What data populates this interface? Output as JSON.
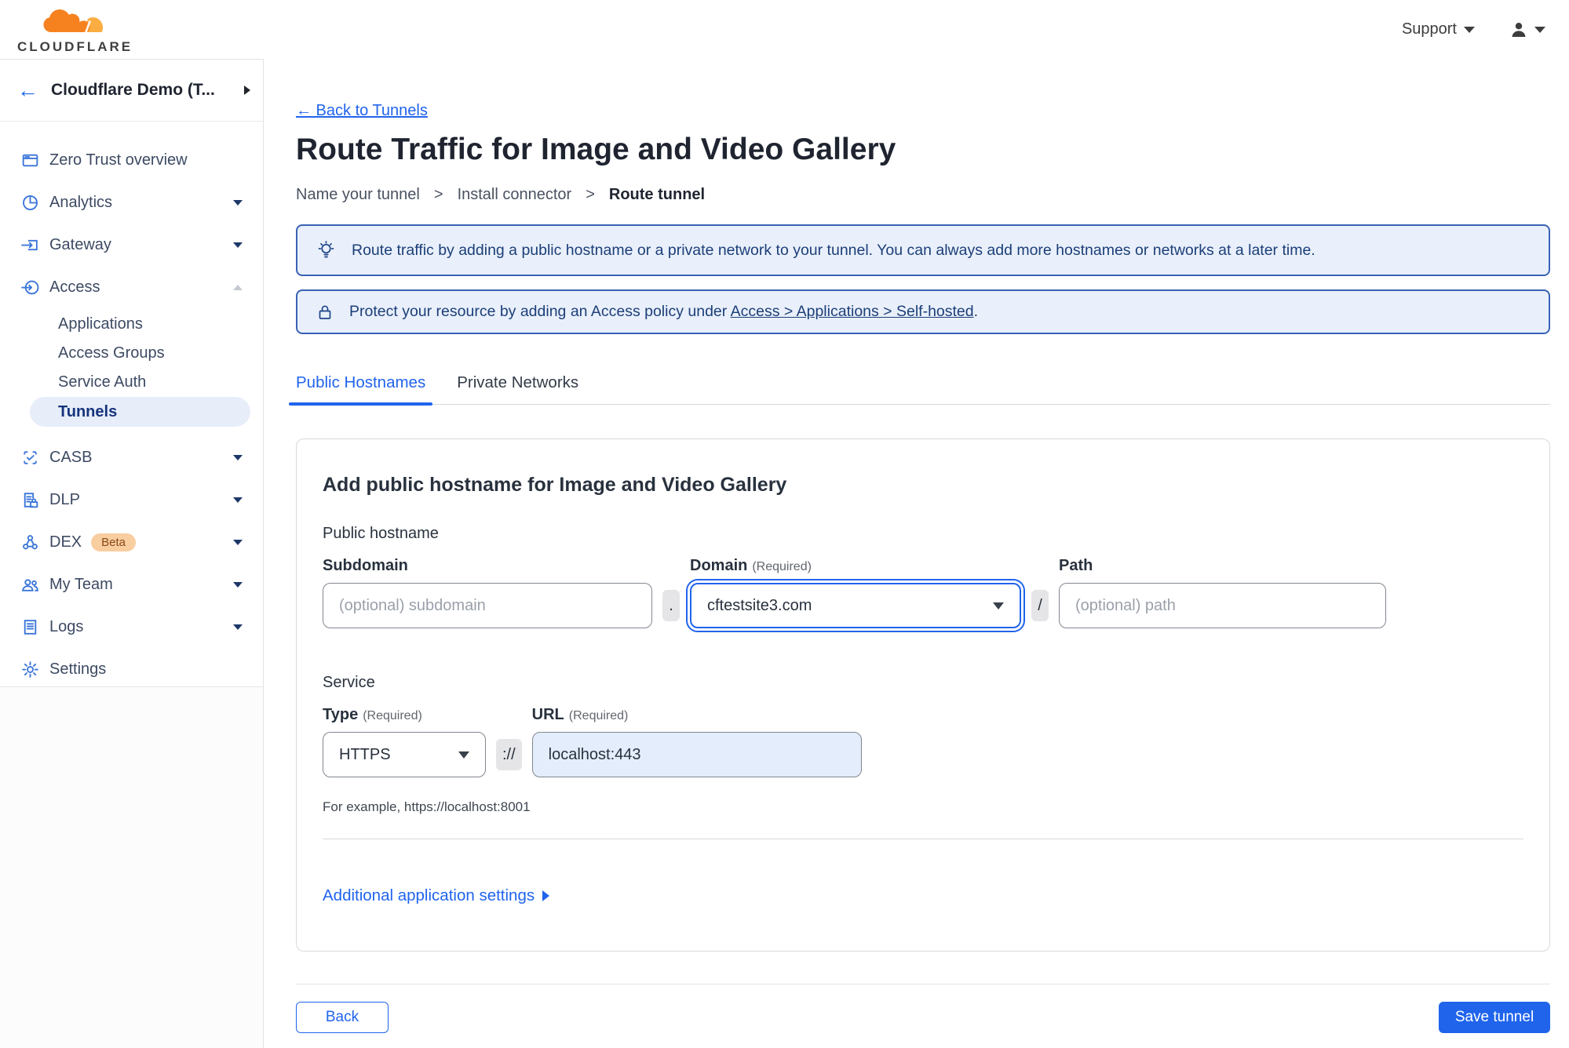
{
  "topbar": {
    "brand": "CLOUDFLARE",
    "support_label": "Support"
  },
  "sidebar": {
    "account_name": "Cloudflare Demo (T...",
    "items": {
      "overview": "Zero Trust overview",
      "analytics": "Analytics",
      "gateway": "Gateway",
      "access": "Access",
      "casb": "CASB",
      "dlp": "DLP",
      "dex": "DEX",
      "dex_badge": "Beta",
      "my_team": "My Team",
      "logs": "Logs",
      "settings": "Settings"
    },
    "access_children": {
      "applications": "Applications",
      "access_groups": "Access Groups",
      "service_auth": "Service Auth",
      "tunnels": "Tunnels"
    }
  },
  "main": {
    "back_link": "← Back to Tunnels",
    "title": "Route Traffic for Image and Video Gallery",
    "breadcrumb": {
      "step1": "Name your tunnel",
      "step2": "Install connector",
      "step3": "Route tunnel",
      "separator": ">"
    },
    "banners": {
      "route_tip": "Route traffic by adding a public hostname or a private network to your tunnel. You can always add more hostnames or networks at a later time.",
      "protect_before": "Protect your resource by adding an Access policy under ",
      "protect_link": "Access > Applications > Self-hosted",
      "protect_after": "."
    },
    "tabs": {
      "public_hostnames": "Public Hostnames",
      "private_networks": "Private Networks"
    },
    "card": {
      "heading": "Add public hostname for Image and Video Gallery",
      "public_hostname_label": "Public hostname",
      "subdomain": {
        "label": "Subdomain",
        "placeholder": "(optional) subdomain"
      },
      "dot": ".",
      "domain": {
        "label": "Domain",
        "required": "(Required)",
        "value": "cftestsite3.com"
      },
      "slash": "/",
      "path": {
        "label": "Path",
        "placeholder": "(optional) path"
      },
      "service_label": "Service",
      "type": {
        "label": "Type",
        "required": "(Required)",
        "value": "HTTPS"
      },
      "scheme": "://",
      "url": {
        "label": "URL",
        "required": "(Required)",
        "value": "localhost:443"
      },
      "example": "For example, https://localhost:8001",
      "additional_settings": "Additional application settings"
    },
    "footer": {
      "back": "Back",
      "save": "Save tunnel"
    }
  },
  "colors": {
    "accent_blue": "#2064ec",
    "brand_orange": "#f6821f",
    "brand_orange_light": "#fbad41",
    "banner_bg": "#e9f0fb",
    "banner_border": "#3a62b5",
    "selected_pill_bg": "#e7eefa",
    "selected_pill_text": "#16337c",
    "url_field_bg": "#e4edfb"
  }
}
